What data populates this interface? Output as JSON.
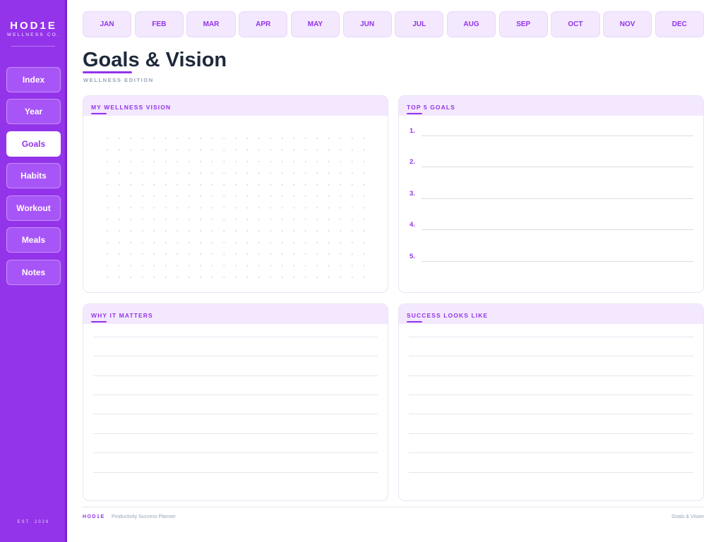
{
  "sidebar": {
    "brand_name": "HOD1E",
    "brand_sub": "WELLNESS CO.",
    "items": [
      {
        "label": "Index",
        "active": false
      },
      {
        "label": "Year",
        "active": false
      },
      {
        "label": "Goals",
        "active": true
      },
      {
        "label": "Habits",
        "active": false
      },
      {
        "label": "Workout",
        "active": false
      },
      {
        "label": "Meals",
        "active": false
      },
      {
        "label": "Notes",
        "active": false
      }
    ],
    "est": "EST. 2026"
  },
  "months": [
    "JAN",
    "FEB",
    "MAR",
    "APR",
    "MAY",
    "JUN",
    "JUL",
    "AUG",
    "SEP",
    "OCT",
    "NOV",
    "DEC"
  ],
  "page": {
    "title": "Goals & Vision",
    "subtitle": "WELLNESS EDITION"
  },
  "cards": {
    "vision": {
      "title": "MY WELLNESS VISION"
    },
    "goals": {
      "title": "TOP 5 GOALS",
      "numbers": [
        "1.",
        "2.",
        "3.",
        "4.",
        "5."
      ]
    },
    "why": {
      "title": "WHY IT MATTERS"
    },
    "success": {
      "title": "SUCCESS LOOKS LIKE"
    }
  },
  "footer": {
    "brand": "HOD1E",
    "separator": "·",
    "tagline": "Productivity Success Planner",
    "page_name": "Goals & Vision"
  },
  "colors": {
    "accent": "#9333ea",
    "sidebar_bg": "#9333ea",
    "nav_item_bg": "#a855f7",
    "tab_bg": "#f3e8fd",
    "title_text": "#1e293b"
  }
}
